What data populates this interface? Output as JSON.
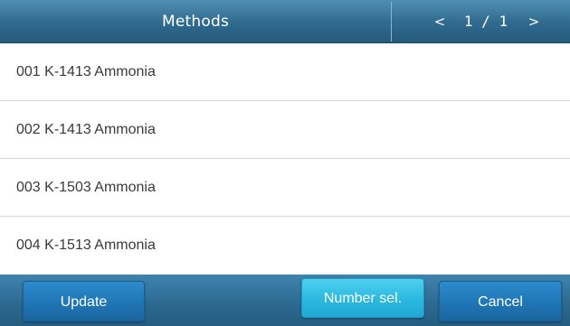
{
  "header": {
    "title": "Methods",
    "pager": {
      "prev_label": "<",
      "next_label": ">",
      "page_text": "1 / 1"
    }
  },
  "methods": [
    {
      "label": "001 K-1413 Ammonia"
    },
    {
      "label": "002 K-1413 Ammonia"
    },
    {
      "label": "003 K-1503 Ammonia"
    },
    {
      "label": "004 K-1513 Ammonia"
    }
  ],
  "footer": {
    "update_label": "Update",
    "number_sel_label": "Number sel.",
    "cancel_label": "Cancel"
  },
  "colors": {
    "header_bar": "#2f6a8e",
    "button_primary": "#1f74b3",
    "button_highlight": "#2ab8e0",
    "list_text": "#3a3a3a",
    "divider": "#d6d6d6"
  }
}
